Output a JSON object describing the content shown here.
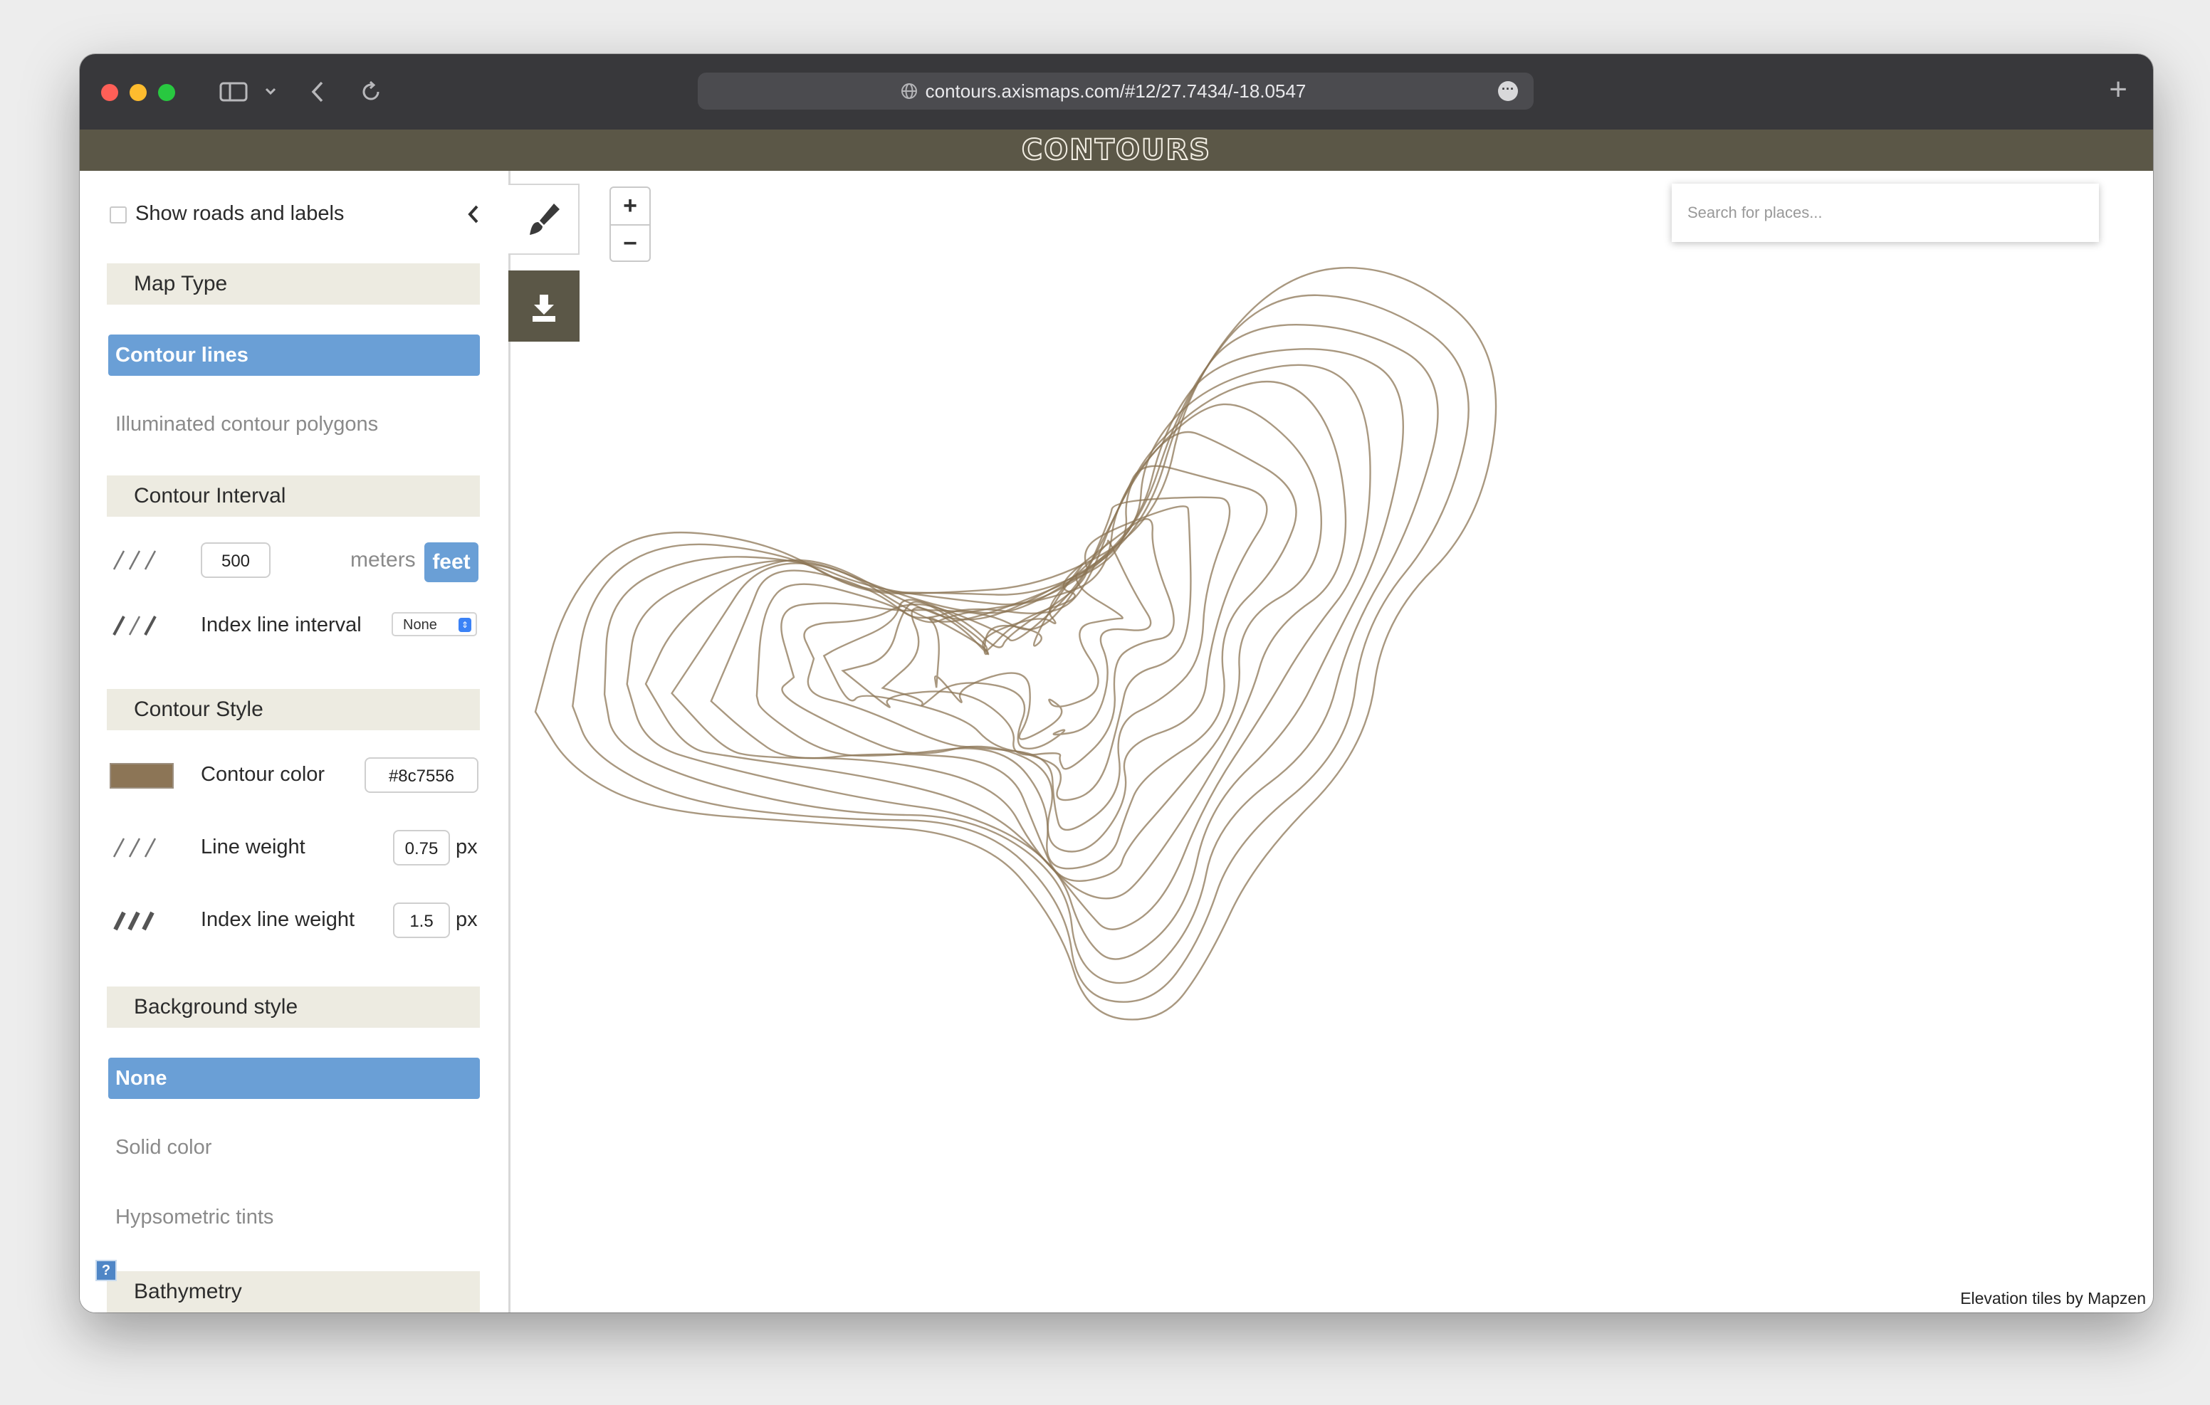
{
  "browser": {
    "url": "contours.axismaps.com/#12/27.7434/-18.0547",
    "icons": [
      "sidebar-toggle-icon",
      "chevron-down-icon",
      "back-icon",
      "reload-icon",
      "globe-icon",
      "more-icon",
      "new-tab-icon"
    ]
  },
  "app": {
    "title": "CONTOURS"
  },
  "sidebar": {
    "show_roads_label": "Show roads and labels",
    "collapse_icon": "chevron-left-icon",
    "map_type": {
      "header": "Map Type",
      "options": [
        "Contour lines",
        "Illuminated contour polygons"
      ],
      "selected": "Contour lines"
    },
    "contour_interval": {
      "header": "Contour Interval",
      "value": "500",
      "unit_meters": "meters",
      "unit_feet": "feet",
      "selected_unit": "feet",
      "index_label": "Index line interval",
      "index_value": "None"
    },
    "contour_style": {
      "header": "Contour Style",
      "color_label": "Contour color",
      "color_value": "#8c7556",
      "line_weight_label": "Line weight",
      "line_weight": "0.75",
      "index_weight_label": "Index line weight",
      "index_weight": "1.5",
      "unit": "px"
    },
    "background": {
      "header": "Background style",
      "options": [
        "None",
        "Solid color",
        "Hypsometric tints"
      ],
      "selected": "None"
    },
    "bathymetry": {
      "header": "Bathymetry"
    },
    "help_label": "?"
  },
  "map": {
    "search_placeholder": "Search for places...",
    "zoom_in": "+",
    "zoom_out": "−",
    "attribution": "Elevation tiles by Mapzen",
    "tools": [
      "brush-icon",
      "download-icon"
    ]
  },
  "colors": {
    "contour": "#8c7556",
    "accent": "#6a9fd6",
    "header_bg": "#5b5747",
    "section_bg": "#edebe1"
  }
}
